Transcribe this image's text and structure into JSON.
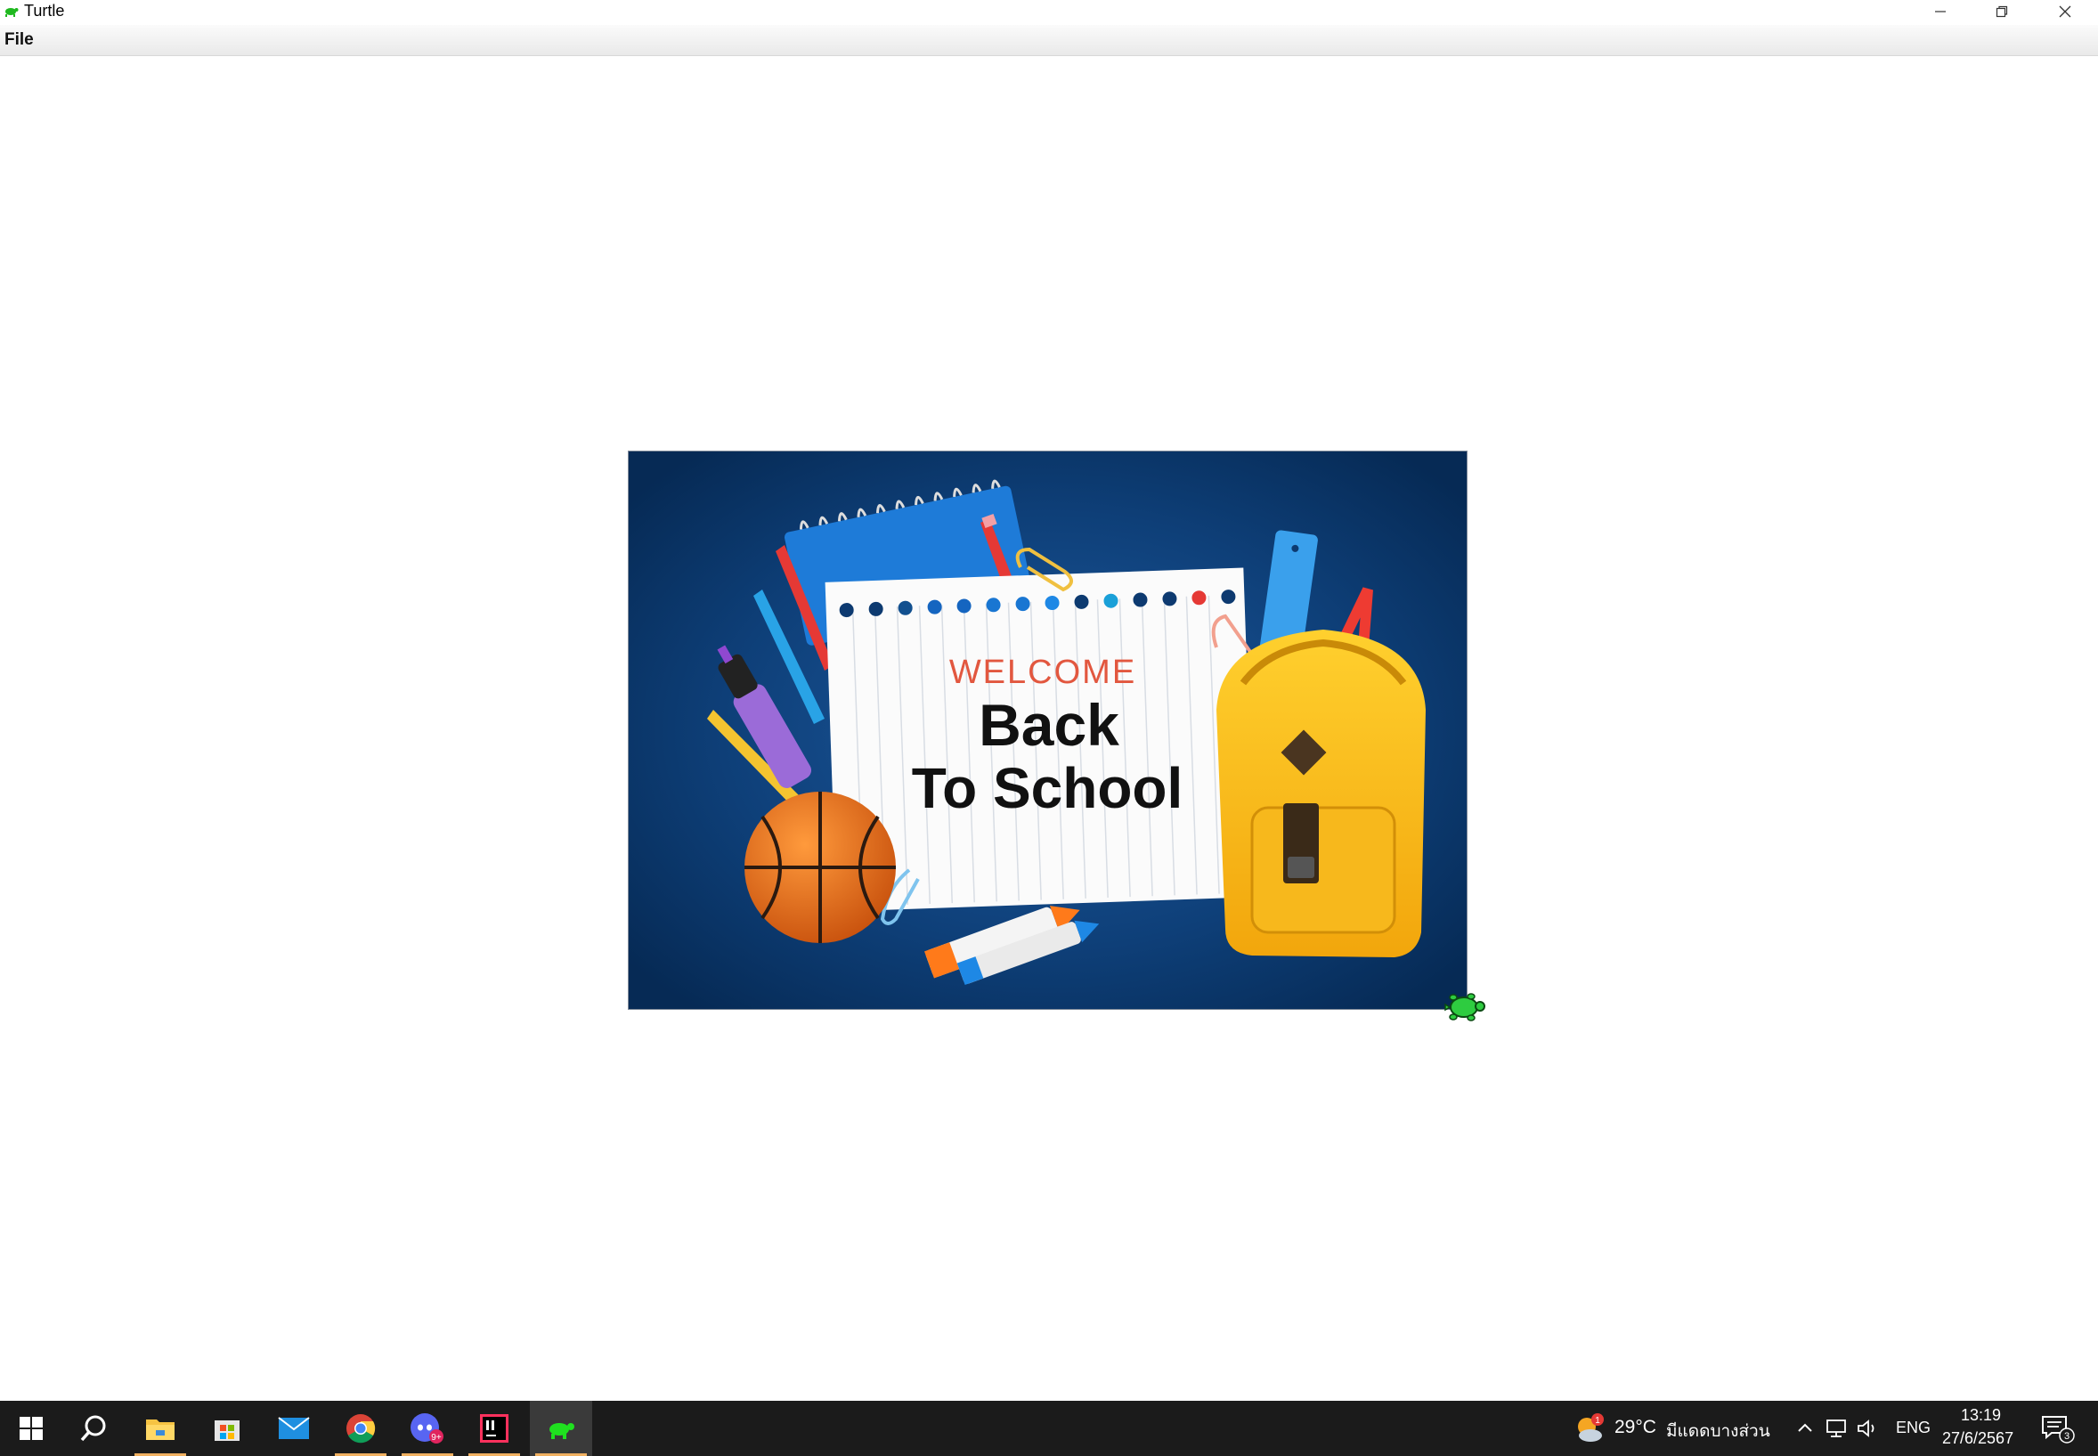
{
  "window": {
    "title": "Turtle",
    "menu": [
      "File"
    ]
  },
  "poster": {
    "welcome": "WELCOME",
    "line1": "Back",
    "line2": "To School"
  },
  "taskbar": {
    "apps": [
      "start",
      "search",
      "file-explorer",
      "microsoft-store",
      "mail",
      "chrome",
      "discord",
      "intellij",
      "turtle"
    ],
    "discord_badge": "9+",
    "weather_badge": "1",
    "weather_temp": "29°C",
    "weather_desc": "มีแดดบางส่วน",
    "language": "ENG",
    "time": "13:19",
    "date": "27/6/2567",
    "notification_count": "3"
  },
  "colors": {
    "poster_bg": "#0b3a6e",
    "turtle": "#2ecc40",
    "taskbar": "#1b1b1b",
    "welcome_red": "#e2573f"
  }
}
